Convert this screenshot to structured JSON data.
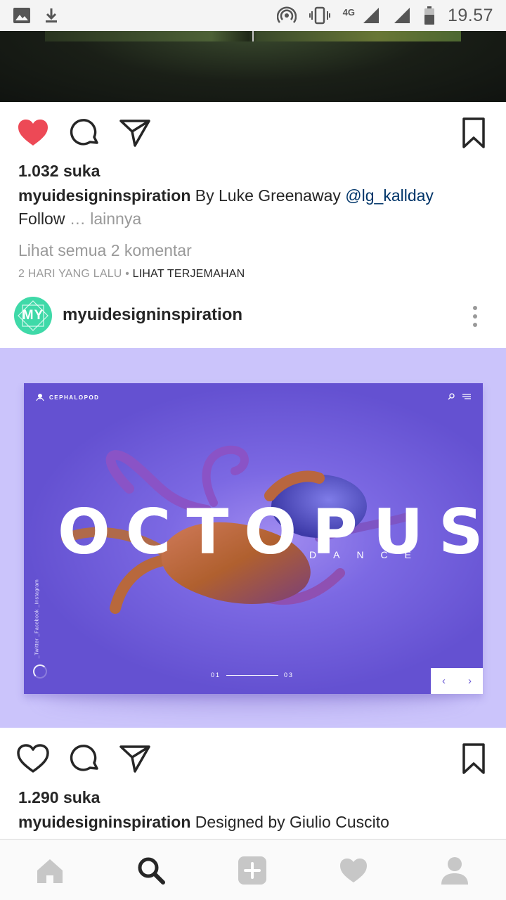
{
  "status_bar": {
    "network": "4G",
    "time": "19.57"
  },
  "post1": {
    "liked": true,
    "likes": "1.032 suka",
    "caption_user": "myuidesigninspiration",
    "caption_text": " By Luke Greenaway ",
    "caption_mention": "@lg_kallday",
    "caption_cont": "Follow",
    "caption_more": " … lainnya",
    "comments_link": "Lihat semua 2 komentar",
    "time_ago": "2 HARI YANG LALU",
    "meta_sep": " • ",
    "translate": "LIHAT TERJEMAHAN"
  },
  "post2": {
    "avatar_text": "MY",
    "username": "myuidesigninspiration",
    "image": {
      "brand": "CEPHALOPOD",
      "title": "OCTOPUS",
      "subtitle": "DANCE",
      "social": "_Twitter  _Facebook  _Instagram",
      "page_current": "01",
      "page_total": "03",
      "prev": "‹",
      "next": "›"
    },
    "liked": false,
    "likes": "1.290 suka",
    "caption_user": "myuidesigninspiration",
    "caption_text": " Designed by Giulio Cuscito"
  },
  "colors": {
    "like_red": "#ed4956",
    "mention_blue": "#003569",
    "image_bg": "#cbc4fb",
    "shot_bg": "#6a5ad4",
    "avatar_green": "#3fd9a8"
  },
  "bottom_nav": [
    "home-icon",
    "search-icon",
    "add-icon",
    "activity-heart-icon",
    "profile-icon"
  ]
}
